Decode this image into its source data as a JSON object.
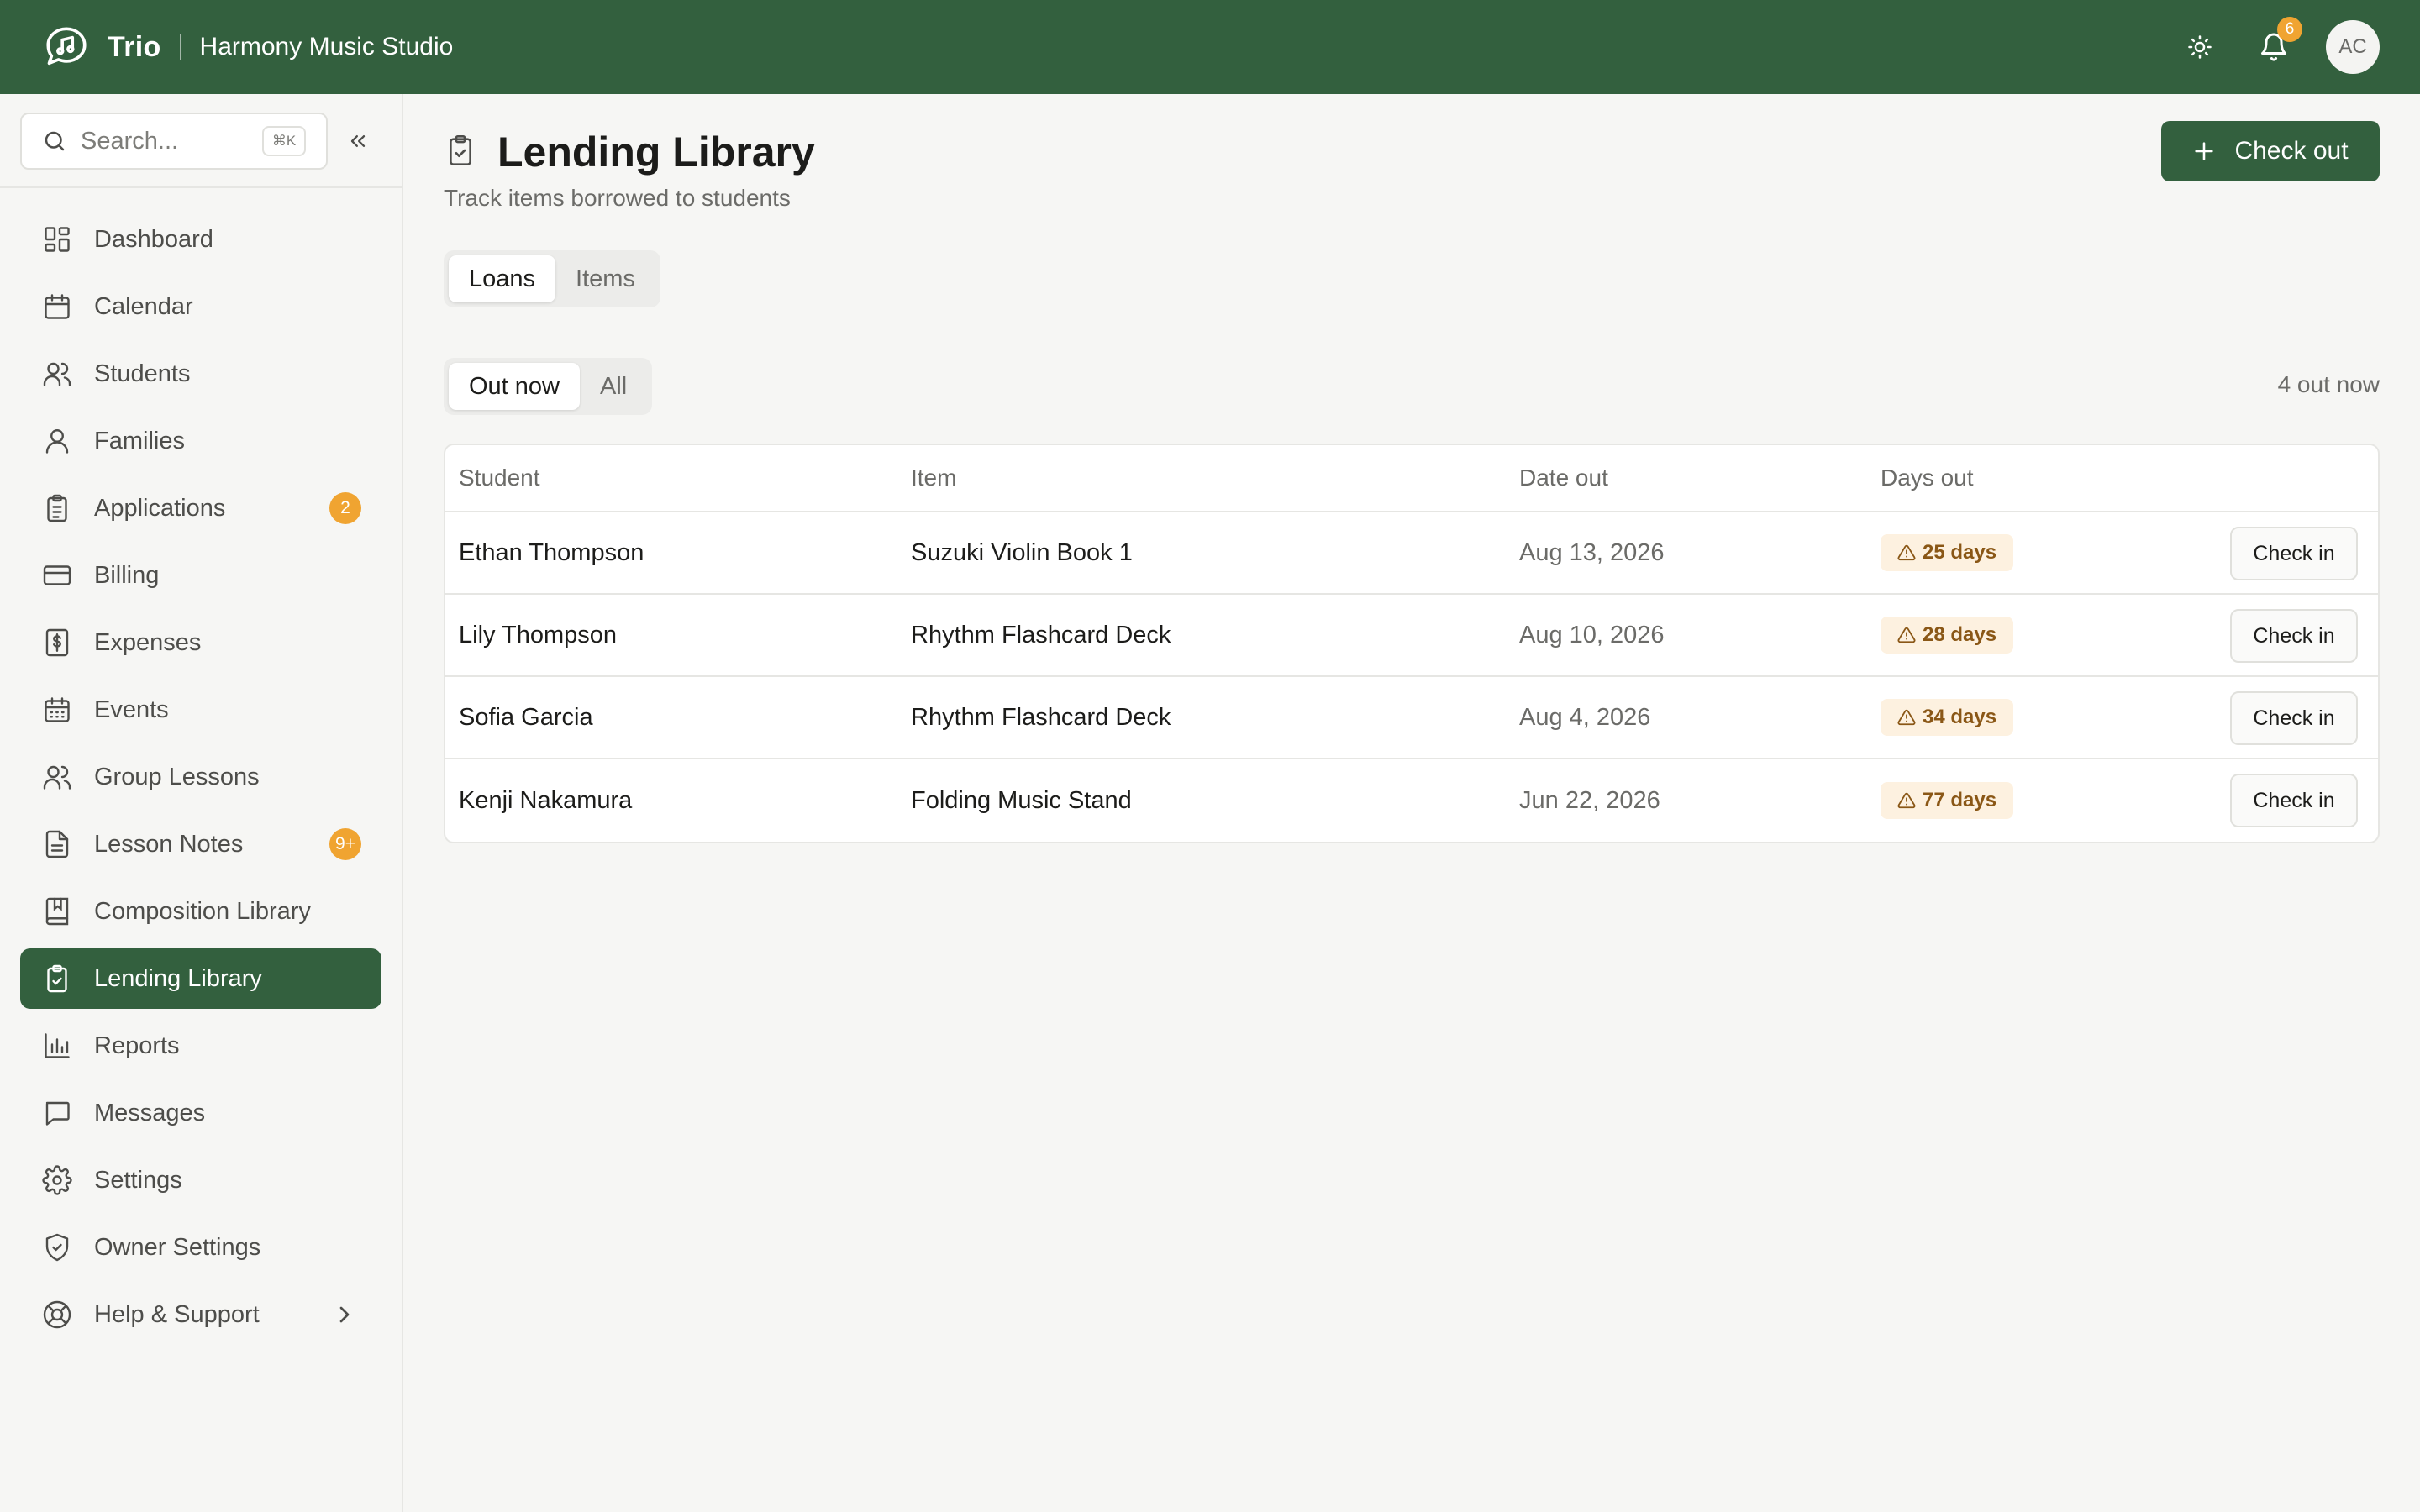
{
  "header": {
    "app_name": "Trio",
    "studio_name": "Harmony Music Studio",
    "notification_count": "6",
    "avatar_initials": "AC"
  },
  "sidebar": {
    "search_placeholder": "Search...",
    "search_shortcut": "⌘K",
    "items": [
      {
        "label": "Dashboard",
        "icon": "dashboard-icon"
      },
      {
        "label": "Calendar",
        "icon": "calendar-icon"
      },
      {
        "label": "Students",
        "icon": "users-icon"
      },
      {
        "label": "Families",
        "icon": "user-icon"
      },
      {
        "label": "Applications",
        "icon": "clipboard-icon",
        "badge": "2"
      },
      {
        "label": "Billing",
        "icon": "credit-card-icon"
      },
      {
        "label": "Expenses",
        "icon": "receipt-icon"
      },
      {
        "label": "Events",
        "icon": "calendar-grid-icon"
      },
      {
        "label": "Group Lessons",
        "icon": "group-icon"
      },
      {
        "label": "Lesson Notes",
        "icon": "document-icon",
        "badge": "9+"
      },
      {
        "label": "Composition Library",
        "icon": "book-icon"
      },
      {
        "label": "Lending Library",
        "icon": "clipboard-check-icon",
        "active": true
      },
      {
        "label": "Reports",
        "icon": "bar-chart-icon"
      },
      {
        "label": "Messages",
        "icon": "message-icon"
      },
      {
        "label": "Settings",
        "icon": "gear-icon"
      },
      {
        "label": "Owner Settings",
        "icon": "shield-icon"
      },
      {
        "label": "Help & Support",
        "icon": "lifebuoy-icon"
      }
    ]
  },
  "main": {
    "title": "Lending Library",
    "subtitle": "Track items borrowed to students",
    "checkout_label": "Check out",
    "tabs": [
      "Loans",
      "Items"
    ],
    "filters": [
      "Out now",
      "All"
    ],
    "count_label": "4 out now",
    "table": {
      "headers": [
        "Student",
        "Item",
        "Date out",
        "Days out"
      ],
      "checkin_label": "Check in",
      "rows": [
        {
          "student": "Ethan Thompson",
          "item": "Suzuki Violin Book 1",
          "date_out": "Aug 13, 2026",
          "days_out": "25 days"
        },
        {
          "student": "Lily Thompson",
          "item": "Rhythm Flashcard Deck",
          "date_out": "Aug 10, 2026",
          "days_out": "28 days"
        },
        {
          "student": "Sofia Garcia",
          "item": "Rhythm Flashcard Deck",
          "date_out": "Aug 4, 2026",
          "days_out": "34 days"
        },
        {
          "student": "Kenji Nakamura",
          "item": "Folding Music Stand",
          "date_out": "Jun 22, 2026",
          "days_out": "77 days"
        }
      ]
    }
  },
  "colors": {
    "brand_green": "#33603e",
    "badge_orange": "#f0a431",
    "warning_bg": "#fdf1e0",
    "warning_text": "#8a5716"
  }
}
